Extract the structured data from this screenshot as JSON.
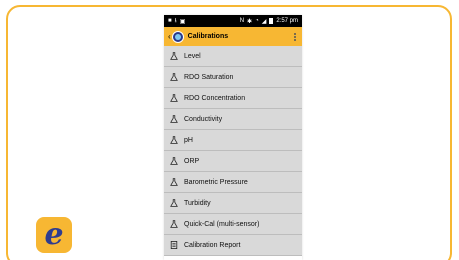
{
  "status_bar": {
    "left_icons": [
      "video-icon",
      "download-icon",
      "photo-icon"
    ],
    "time": "2:57 pm"
  },
  "app_bar": {
    "title": "Calibrations"
  },
  "menu_items": [
    {
      "label": "Level",
      "icon": "flask-icon"
    },
    {
      "label": "RDO Saturation",
      "icon": "flask-icon"
    },
    {
      "label": "RDO Concentration",
      "icon": "flask-icon"
    },
    {
      "label": "Conductivity",
      "icon": "flask-icon"
    },
    {
      "label": "pH",
      "icon": "flask-icon"
    },
    {
      "label": "ORP",
      "icon": "flask-icon"
    },
    {
      "label": "Barometric Pressure",
      "icon": "flask-icon"
    },
    {
      "label": "Turbidity",
      "icon": "flask-icon"
    },
    {
      "label": "Quick-Cal (multi-sensor)",
      "icon": "flask-icon"
    },
    {
      "label": "Calibration Report",
      "icon": "report-icon"
    }
  ],
  "brand_logo": {
    "letter": "e"
  },
  "colors": {
    "accent": "#f7b733",
    "list_bg": "#d9d9d9",
    "logo_text": "#2e3c8f"
  }
}
